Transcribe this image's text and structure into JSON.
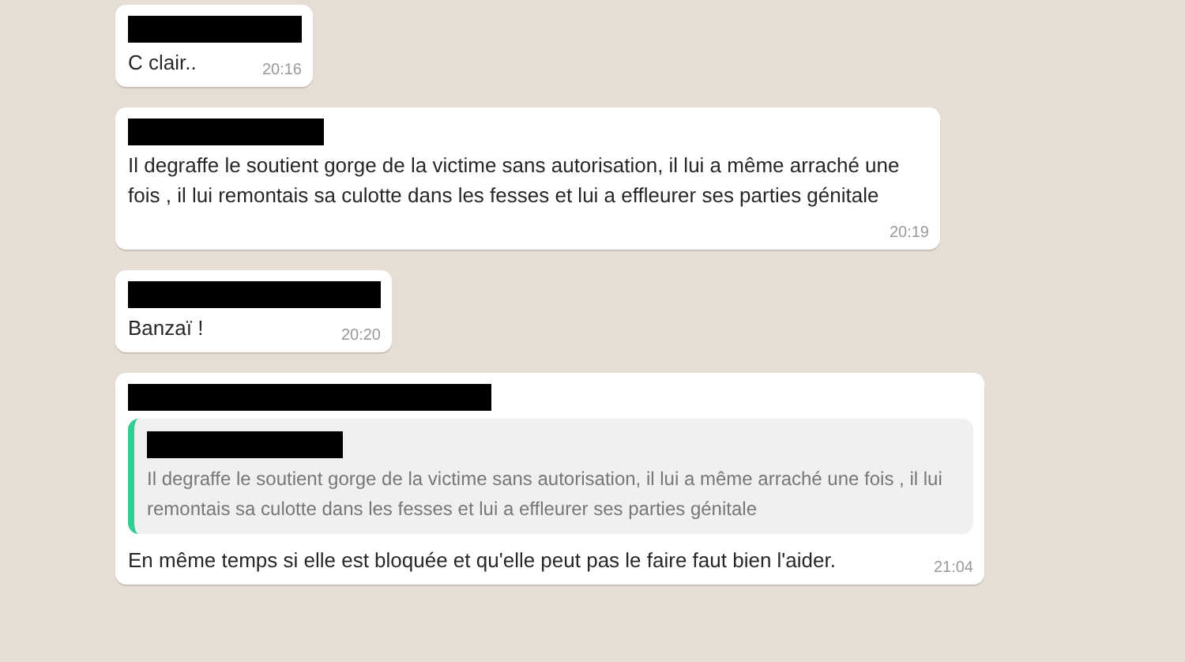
{
  "messages": [
    {
      "sender_redacted": true,
      "text": "C clair..",
      "time": "20:16"
    },
    {
      "sender_redacted": true,
      "text": "Il degraffe le soutient gorge de la victime sans autorisation, il lui a même arraché une fois , il lui remontais sa culotte dans les fesses et lui a effleurer ses parties génitale",
      "time": "20:19"
    },
    {
      "sender_redacted": true,
      "text": "Banzaï !",
      "time": "20:20"
    },
    {
      "sender_redacted": true,
      "quote": {
        "sender_redacted": true,
        "text": "Il degraffe le soutient gorge de la victime sans autorisation, il lui a même arraché une fois , il lui remontais sa culotte dans les fesses et lui a effleurer ses parties génitale"
      },
      "text": "En même temps si elle est bloquée et qu'elle peut pas le faire faut bien l'aider.",
      "time": "21:04"
    }
  ]
}
